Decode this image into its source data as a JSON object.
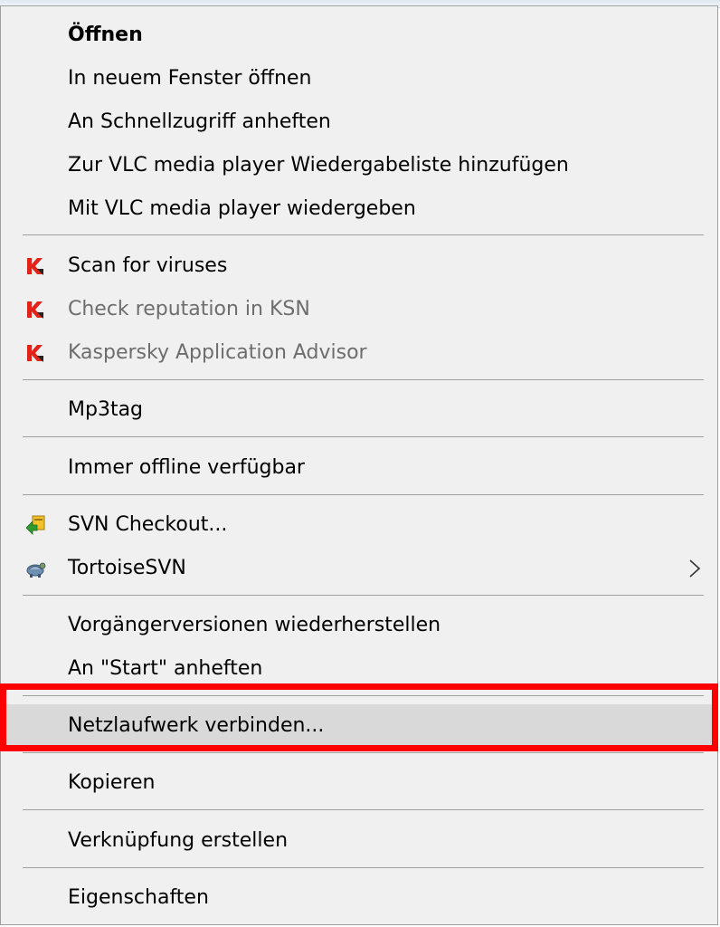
{
  "menu": {
    "open": "Öffnen",
    "open_new_window": "In neuem Fenster öffnen",
    "pin_quick_access": "An Schnellzugriff anheften",
    "vlc_add_playlist": "Zur VLC media player Wiedergabeliste hinzufügen",
    "vlc_play": "Mit VLC media player wiedergeben",
    "scan_viruses": "Scan for viruses",
    "check_ksn": "Check reputation in KSN",
    "kaspersky_advisor": "Kaspersky Application Advisor",
    "mp3tag": "Mp3tag",
    "always_offline": "Immer offline verfügbar",
    "svn_checkout": "SVN Checkout...",
    "tortoisesvn": "TortoiseSVN",
    "restore_previous": "Vorgängerversionen wiederherstellen",
    "pin_start": "An \"Start\" anheften",
    "map_network_drive": "Netzlaufwerk verbinden...",
    "copy": "Kopieren",
    "create_shortcut": "Verknüpfung erstellen",
    "properties": "Eigenschaften"
  },
  "icons": {
    "kaspersky": "kaspersky-icon",
    "svn_checkout": "svn-checkout-icon",
    "tortoisesvn": "tortoisesvn-icon",
    "submenu": "chevron-right-icon"
  },
  "colors": {
    "menu_bg": "#f0f0f0",
    "hover_bg": "#d9d9d9",
    "separator": "#a0a0a0",
    "disabled_text": "#6d6d6d",
    "highlight": "#ff0000",
    "kaspersky_red": "#e2231a"
  }
}
